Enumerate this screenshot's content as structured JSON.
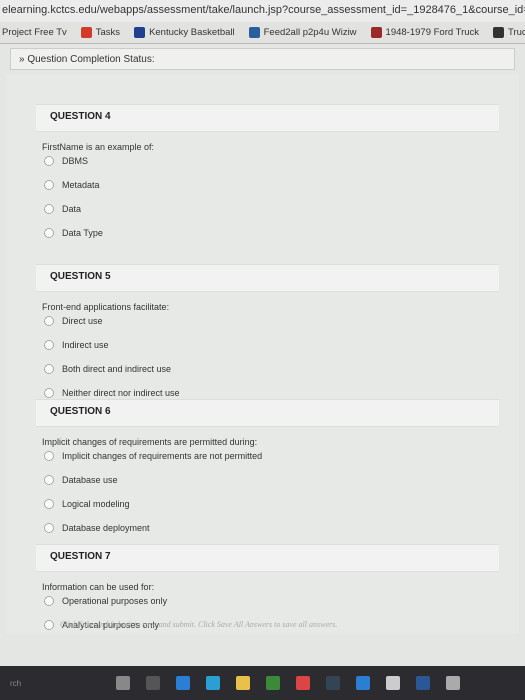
{
  "browser": {
    "url": "elearning.kctcs.edu/webapps/assessment/take/launch.jsp?course_assessment_id=_1928476_1&course_id=_493459",
    "bookmarks": [
      {
        "label": "Project Free Tv",
        "color": ""
      },
      {
        "label": "Tasks",
        "color": "#d23a2a"
      },
      {
        "label": "Kentucky Basketball",
        "color": "#1f3f8f"
      },
      {
        "label": "Feed2all p2p4u Wiziw",
        "color": "#2a5f9f"
      },
      {
        "label": "1948-1979 Ford Truck",
        "color": "#9a2a2a"
      },
      {
        "label": "Truck Parts and",
        "color": "#333333"
      }
    ]
  },
  "status": {
    "label": "Question Completion Status:"
  },
  "questions": [
    {
      "title": "QUESTION 4",
      "text": "FirstName is an example of:",
      "options": [
        "DBMS",
        "Metadata",
        "Data",
        "Data Type"
      ]
    },
    {
      "title": "QUESTION 5",
      "text": "Front-end applications facilitate:",
      "options": [
        "Direct use",
        "Indirect use",
        "Both direct and indirect use",
        "Neither direct nor indirect use"
      ]
    },
    {
      "title": "QUESTION 6",
      "text": "Implicit changes of requirements are permitted during:",
      "options": [
        "Implicit changes of requirements are not permitted",
        "Database use",
        "Logical modeling",
        "Database deployment"
      ]
    },
    {
      "title": "QUESTION 7",
      "text": "Information can be used for:",
      "options": [
        "Operational purposes only",
        "Analytical purposes only"
      ]
    }
  ],
  "footer_note": "Click Save and Submit to save and submit. Click Save All Answers to save all answers.",
  "taskbar": {
    "search": "rch",
    "icons": [
      "microphone-icon",
      "task-view-icon",
      "edge-icon",
      "store-icon",
      "files-icon",
      "chrome-icon",
      "steam-icon",
      "ie-icon",
      "app-icon",
      "word-icon",
      "photos-icon",
      "media-icon"
    ]
  }
}
